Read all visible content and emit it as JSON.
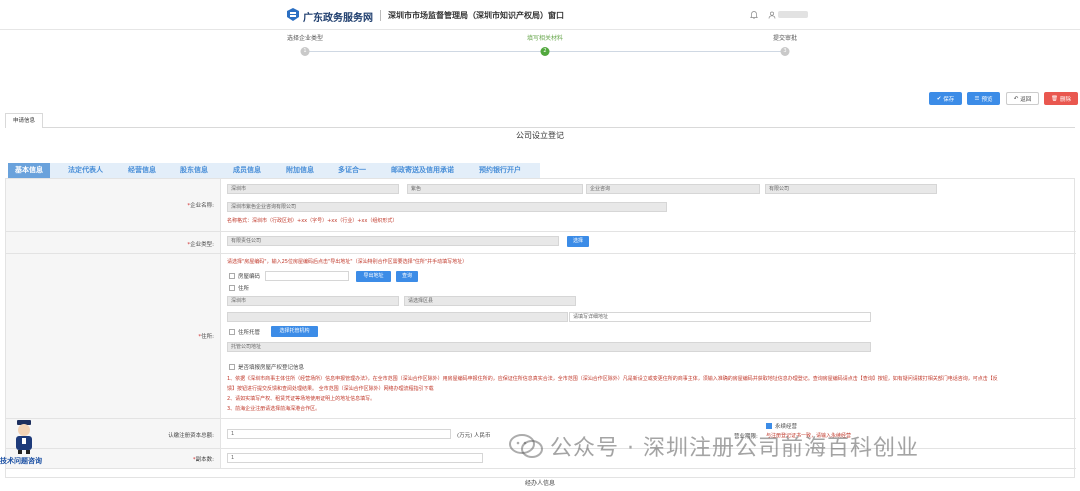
{
  "header": {
    "brand": "广东政务服务网",
    "window_title": "深圳市市场监督管理局（深圳市知识产权局）窗口"
  },
  "steps": [
    {
      "label": "选择企业类型",
      "num": "1",
      "active": false
    },
    {
      "label": "填写相关材料",
      "num": "2",
      "active": true
    },
    {
      "label": "提交审批",
      "num": "3",
      "active": false
    }
  ],
  "toolbar": {
    "save": "保存",
    "preview": "预览",
    "back": "返回",
    "delete": "删除"
  },
  "tabs": {
    "apply_info": "申请信息"
  },
  "page_title": "公司设立登记",
  "section_nav": [
    "基本信息",
    "法定代表人",
    "经营信息",
    "股东信息",
    "成员信息",
    "附加信息",
    "多证合一",
    "邮政寄送及信用承诺",
    "预约银行开户"
  ],
  "company_name": {
    "label": "企业名称:",
    "f1": "深圳市",
    "f2": "紫色",
    "f3": "企业咨询",
    "f4": "有限公司",
    "full": "深圳市紫色企业咨询有限公司",
    "hint": "名称格式：深圳市（行政区划）+xx（字号）+xx（行业）+xx（组织形式）"
  },
  "company_type": {
    "label": "企业类型:",
    "value": "有限责任公司",
    "select_btn": "选择"
  },
  "address": {
    "label": "住所:",
    "hint": "请选择\"房屋编码\"，输入25位房屋编码后点击\"导出地址\"（深汕特别合作区需要选择\"住所\"并手动填写地址）",
    "house_code": "房屋编码",
    "export_btn": "导出地址",
    "query_btn": "查询",
    "residence": "住所",
    "city": "深圳市",
    "district_placeholder": "请选择区县",
    "detail_placeholder": "请填写详细地址",
    "trust": "住所托管",
    "trust_btn": "选择托管机构",
    "trust_placeholder": "托管公司地址",
    "property_reg": "是否填报房屋产权登记信息",
    "note1": "1、依据《深圳市商事主体住所（经营场所）信息申报管理办法》，在全市范围（深汕合作区除外）用房屋编码申报住所的，应保证住所信息真实合法，全市范围（深汕合作区除外）凡是新设立或变更住所的商事主体，须输入准确的房屋编码并获取地址信息办理登记。查询房屋编码请点击【查询】按钮，如有疑问请拨打相关部门电话咨询，可点击【反",
    "note2": "馈】按钮进行提交反馈和查阅处理结果。 全市范围（深汕合作区除外）网络办理流程指引下载",
    "note3": "2、请如实填写产权、租赁凭证等场地使用证明上的地址信息填写。",
    "note4": "3、前海企业注册请选择前海深港合作区。"
  },
  "capital": {
    "label": "认缴注册资本总额:",
    "value": "1",
    "unit": "(万元) 人民币",
    "term_label": "营业期限:",
    "permanent": "永续经营",
    "term_note": "与注册登记证书一致，请输入永续经营"
  },
  "copies": {
    "label": "副本数:",
    "value": "1"
  },
  "help": {
    "text": "技术问题咨询"
  },
  "watermark": {
    "text": "公众号 · 深圳注册公司前海百科创业"
  },
  "footer": {
    "label": "经办人信息"
  }
}
